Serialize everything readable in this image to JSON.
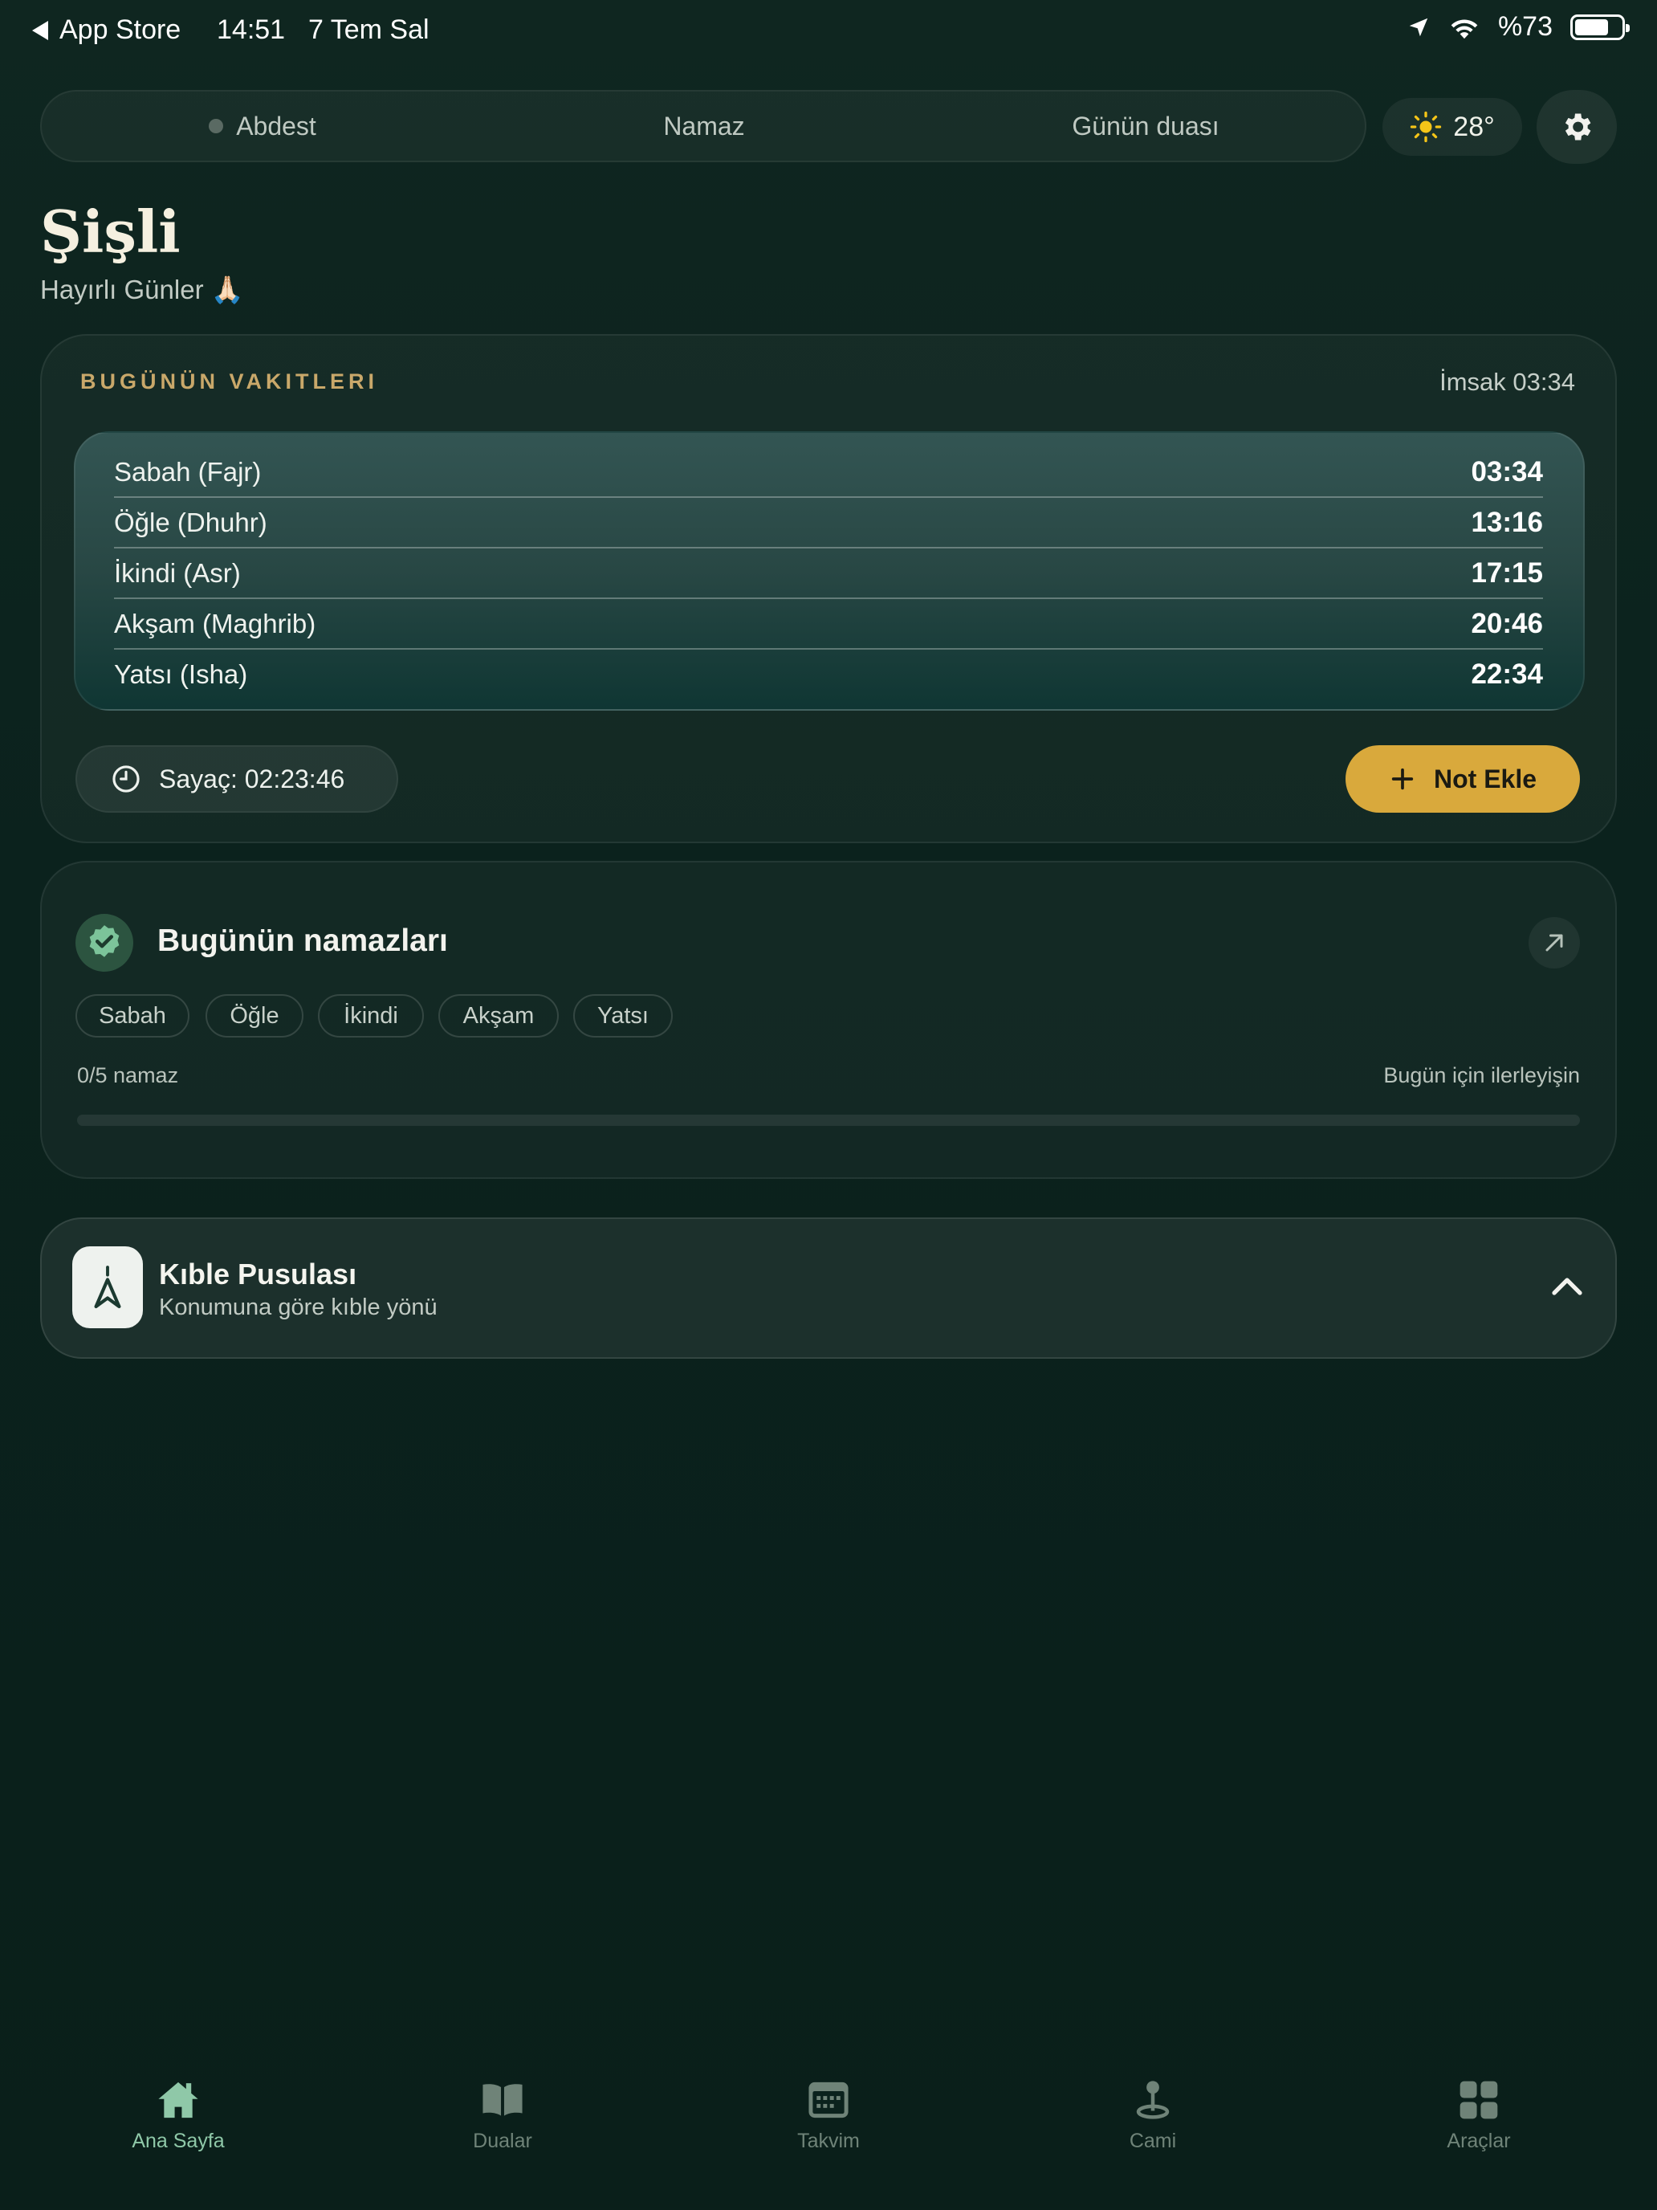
{
  "status_bar": {
    "back_label": "App Store",
    "time": "14:51",
    "date": "7 Tem Sal",
    "battery": "%73",
    "battery_level": 0.73
  },
  "segment": {
    "items": [
      {
        "label": "Abdest"
      },
      {
        "label": "Namaz"
      },
      {
        "label": "Günün duası"
      }
    ]
  },
  "weather": {
    "temp": "28°",
    "icon": "sun-icon"
  },
  "header": {
    "city": "Şişli",
    "greeting": "Hayırlı Günler 🙏🏻"
  },
  "today_times": {
    "section_title": "BUGÜNÜN VAKITLERI",
    "imsak": "İmsak 03:34",
    "rows": [
      {
        "name": "Sabah (Fajr)",
        "time": "03:34"
      },
      {
        "name": "Öğle (Dhuhr)",
        "time": "13:16"
      },
      {
        "name": "İkindi (Asr)",
        "time": "17:15"
      },
      {
        "name": "Akşam (Maghrib)",
        "time": "20:46"
      },
      {
        "name": "Yatsı (Isha)",
        "time": "22:34"
      }
    ],
    "counter": "Sayaç: 02:23:46",
    "add_note": "Not Ekle"
  },
  "today_prayers": {
    "title": "Bugünün namazları",
    "chips": [
      "Sabah",
      "Öğle",
      "İkindi",
      "Akşam",
      "Yatsı"
    ],
    "count": "0/5 namaz",
    "progress_label": "Bugün için ilerleyişin",
    "progress": 0
  },
  "qibla": {
    "title": "Kıble Pusulası",
    "subtitle": "Konumuna göre kıble yönü"
  },
  "tabbar": {
    "items": [
      {
        "label": "Ana Sayfa",
        "icon": "home-icon",
        "active": true
      },
      {
        "label": "Dualar",
        "icon": "book-icon",
        "active": false
      },
      {
        "label": "Takvim",
        "icon": "calendar-icon",
        "active": false
      },
      {
        "label": "Cami",
        "icon": "mosque-pin-icon",
        "active": false
      },
      {
        "label": "Araçlar",
        "icon": "grid-icon",
        "active": false
      }
    ]
  },
  "colors": {
    "background": "#0b221d",
    "accent_gold": "#d9a93c",
    "section_title": "#c9a86a",
    "active_tab": "#8fc8a8"
  }
}
